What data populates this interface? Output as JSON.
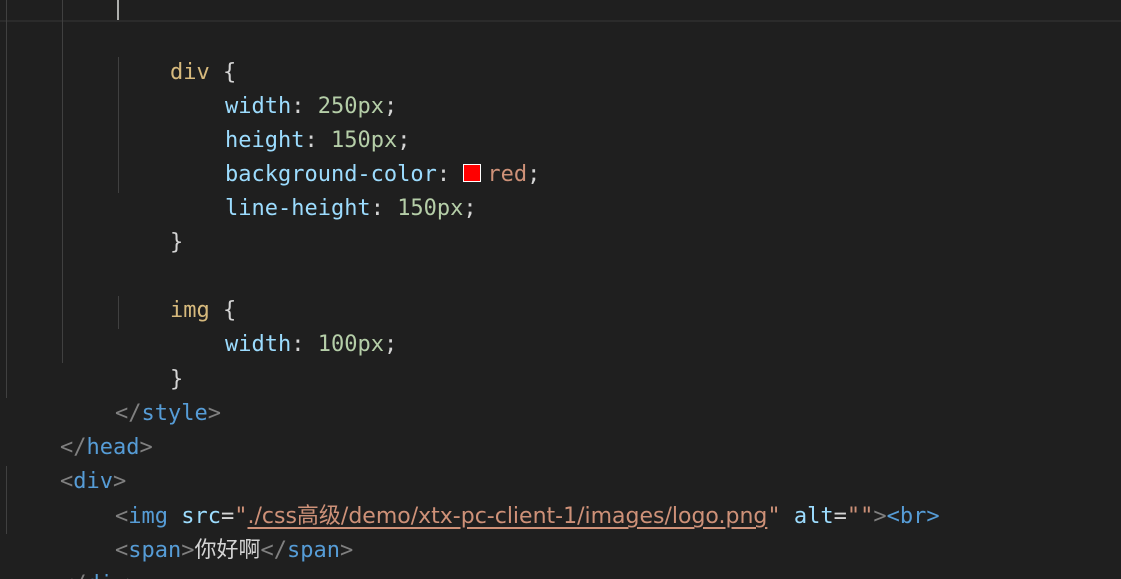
{
  "code": {
    "div_rule": {
      "selector": "div",
      "open": "{",
      "close": "}",
      "decls": [
        {
          "prop": "width",
          "colon": ":",
          "value": "250px",
          "semi": ";"
        },
        {
          "prop": "height",
          "colon": ":",
          "value": "150px",
          "semi": ";"
        },
        {
          "prop": "background-color",
          "colon": ":",
          "value": "red",
          "semi": ";",
          "swatch": "#ff0000"
        },
        {
          "prop": "line-height",
          "colon": ":",
          "value": "150px",
          "semi": ";"
        }
      ]
    },
    "img_rule": {
      "selector": "img",
      "open": "{",
      "close": "}",
      "decls": [
        {
          "prop": "width",
          "colon": ":",
          "value": "100px",
          "semi": ";"
        }
      ]
    },
    "style_close": {
      "lt": "</",
      "name": "style",
      "gt": ">"
    },
    "head_close": {
      "lt": "</",
      "name": "head",
      "gt": ">"
    },
    "div_open": {
      "lt": "<",
      "name": "div",
      "gt": ">"
    },
    "img_tag": {
      "lt": "<",
      "name": "img",
      "src_attr": "src",
      "eq": "=",
      "q": "\"",
      "src_value": "./css高级/demo/xtx-pc-client-1/images/logo.png",
      "alt_attr": "alt",
      "alt_value": "\"\"",
      "gt": ">",
      "br": "<br>"
    },
    "span_line": {
      "open_lt": "<",
      "name": "span",
      "gt": ">",
      "text": "你好啊",
      "close_lt": "</"
    },
    "div_close": {
      "lt": "</",
      "name": "div",
      "gt": ">"
    }
  },
  "colors": {
    "background": "#1f1f1f",
    "tag": "#569cd6",
    "attribute": "#9cdcfe",
    "string": "#ce9178",
    "selector": "#d7ba7d",
    "number": "#b5cea8",
    "punctuation": "#808080"
  }
}
